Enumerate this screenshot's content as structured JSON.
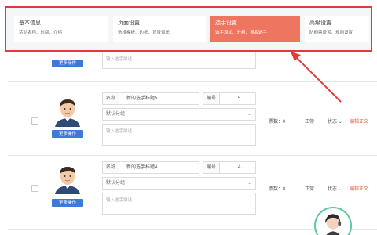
{
  "steps": [
    {
      "title": "基本信息",
      "sub": "活动名称、时间、介绍"
    },
    {
      "title": "页面设置",
      "sub": "选择模板、边框、背景音乐"
    },
    {
      "title": "选手设置",
      "sub": "选手添加、分组、报名选手"
    },
    {
      "title": "高级设置",
      "sub": "防刷票设置、规则设置"
    }
  ],
  "rows": [
    {
      "more": "更多操作",
      "desc_placeholder": "输入选手描述"
    },
    {
      "name_label": "名称",
      "name_value": "新的选手标题5",
      "num_label": "编号",
      "num_value": "5",
      "group": "默认分组",
      "desc_placeholder": "输入选手描述",
      "more": "更多操作",
      "votes": "票数：0",
      "status_value": "正常",
      "status_toggle": "状态",
      "edit": "编辑正文"
    },
    {
      "name_label": "名称",
      "name_value": "新的选手标题4",
      "num_label": "编号",
      "num_value": "4",
      "group": "默认分组",
      "desc_placeholder": "输入选手描述",
      "more": "更多操作",
      "votes": "票数：0",
      "status_value": "正常",
      "status_toggle": "状态",
      "edit": "编辑正文"
    }
  ],
  "colors": {
    "accent": "#ee7660",
    "highlight": "#e23a3a",
    "button": "#3b7bd7"
  }
}
